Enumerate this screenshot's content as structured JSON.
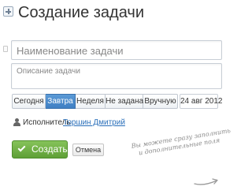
{
  "header": {
    "title": "Создание задачи"
  },
  "form": {
    "name_placeholder": "Наименование задачи",
    "description_placeholder": "Описание задачи"
  },
  "due": {
    "options": [
      "Сегодня",
      "Завтра",
      "Неделя",
      "Не задана",
      "Вручную"
    ],
    "selected": "Завтра",
    "date": "24 авг 2012"
  },
  "assignee": {
    "label": "Исполнитель",
    "name": "Торшин Дмитрий"
  },
  "actions": {
    "create_label": "Создать",
    "cancel_label": "Отмена"
  },
  "hint": {
    "line1": "Вы можете сразу заполнить",
    "line2": "и дополнительные поля"
  },
  "colors": {
    "accent_blue": "#4a8bcc",
    "create_green": "#6fae45",
    "link": "#2a6fba"
  }
}
